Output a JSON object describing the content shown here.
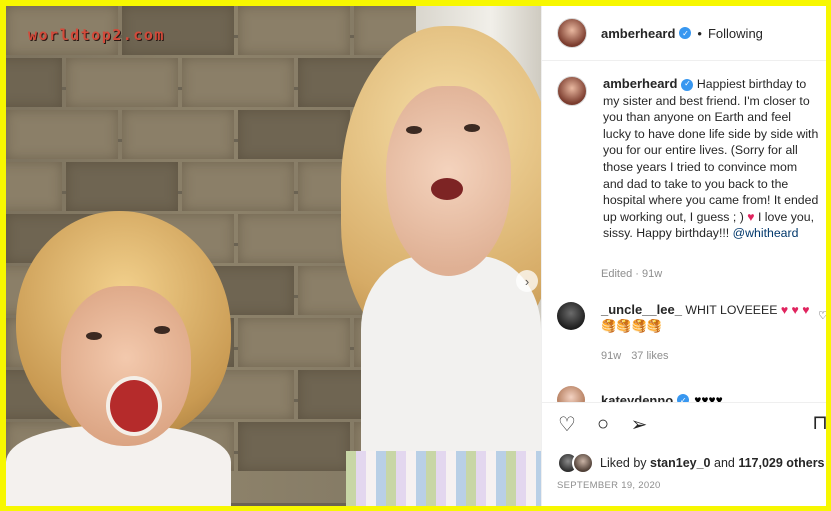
{
  "watermark": "worldtop2.com",
  "post": {
    "username": "amberheard",
    "follow_status": "Following",
    "separator": "•",
    "caption": "Happiest birthday to my sister and best friend. I'm closer to you than anyone on Earth and feel lucky to have done life side by side with you for our entire lives. (Sorry for all those years I tried to convince mom and dad to take to you back to the hospital where you came from! It ended up working out, I guess ; )",
    "caption_heart": "♥",
    "caption_end": "I love you, sissy. Happy birthday!!!",
    "caption_mention": "@whitheard",
    "edited": "Edited · 91w",
    "next_icon": "›"
  },
  "comments": [
    {
      "username": "_uncle__lee_",
      "text": "WHIT LOVEEEE",
      "emoji": "♥ ♥ ♥ 🥞🥞🥞🥞",
      "age": "91w",
      "likes": "37 likes"
    }
  ],
  "partial_comment": {
    "username": "kateydenno",
    "text": "♥♥♥♥"
  },
  "actions": {
    "like_icon": "♡",
    "comment_icon": "○",
    "share_icon": "➢",
    "save_icon": "⊓"
  },
  "likes": {
    "prefix": "Liked by",
    "user": "stan1ey_0",
    "and": "and",
    "others": "117,029 others"
  },
  "date": "SEPTEMBER 19, 2020"
}
